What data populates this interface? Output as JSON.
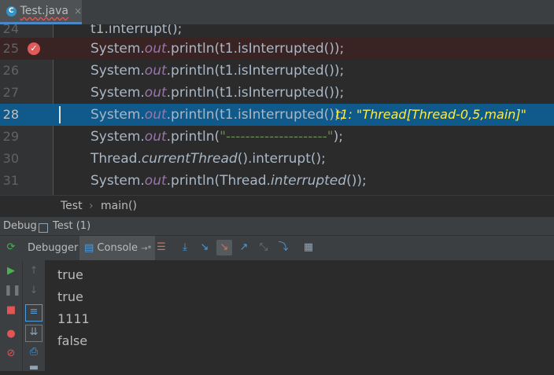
{
  "tab": {
    "label": "Test.java",
    "close": "×",
    "icon_letter": "C"
  },
  "editor": {
    "lines": [
      {
        "num": "24",
        "code": "t1.interrupt();"
      },
      {
        "num": "25",
        "pre": "System.",
        "out": "out",
        "post": ".println(t1.isInterrupted());"
      },
      {
        "num": "26",
        "pre": "System.",
        "out": "out",
        "post": ".println(t1.isInterrupted());"
      },
      {
        "num": "27",
        "pre": "System.",
        "out": "out",
        "post": ".println(t1.isInterrupted());"
      },
      {
        "num": "28",
        "pre": "System.",
        "out": "out",
        "post": ".println(t1.isInterrupted());",
        "inline_value": "t1: \"Thread[Thread-0,5,main]\""
      },
      {
        "num": "29",
        "pre": "System.",
        "out": "out",
        "mid": ".println(",
        "str": "\"---------------------\"",
        "post": ");"
      },
      {
        "num": "30",
        "pre": "Thread.",
        "method": "currentThread",
        "post": "().interrupt();"
      },
      {
        "num": "31",
        "pre": "System.",
        "out": "out",
        "mid": ".println(Thread.",
        "method": "interrupted",
        "post": "());"
      }
    ]
  },
  "breadcrumb": {
    "class": "Test",
    "sep": "›",
    "method": "main()"
  },
  "debug_header": {
    "label": "Debug",
    "config": "Test (1)"
  },
  "toolbar": {
    "debugger": "Debugger",
    "console": "Console",
    "console_suffix": "→*"
  },
  "console_output": [
    "true",
    "true",
    "1111",
    "false"
  ],
  "colors": {
    "breakpoint_line": "#3a2323",
    "execution_line": "#0f5a8a",
    "inline_value": "#ffeb3b"
  }
}
